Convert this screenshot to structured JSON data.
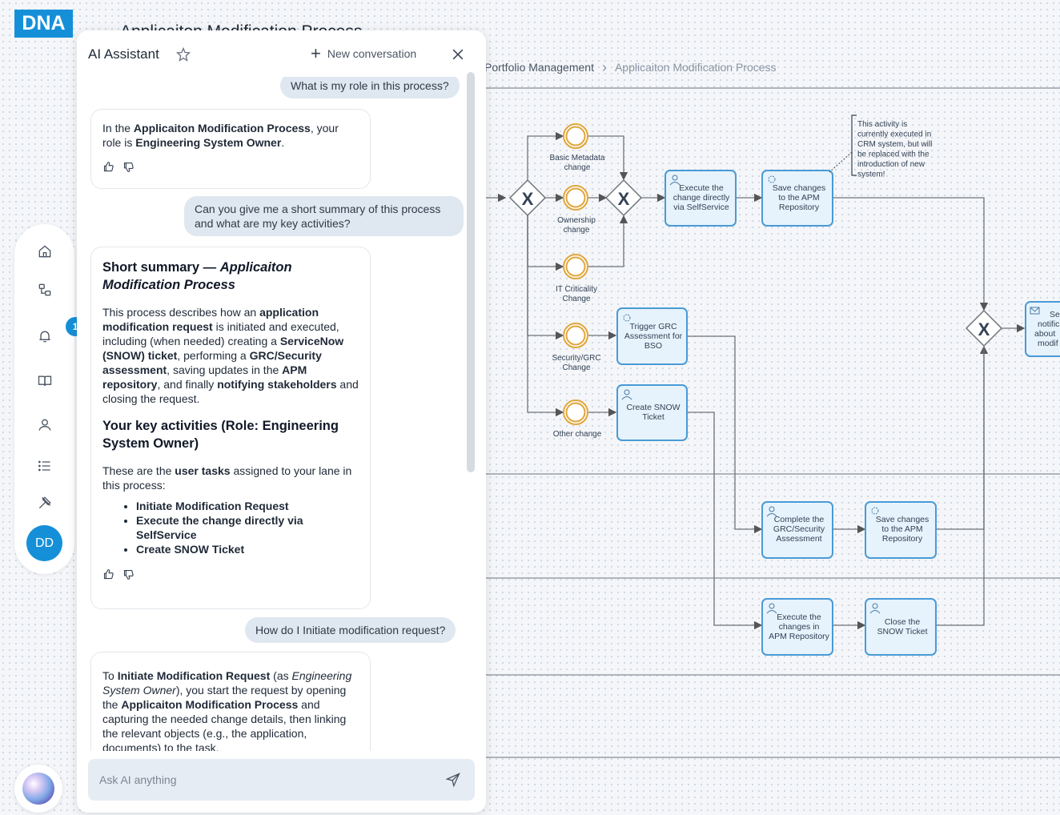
{
  "app": {
    "logo": "DNA",
    "page_title": "Applicaiton Modification Process"
  },
  "breadcrumb": {
    "parent": "Portfolio Management",
    "separator": ">",
    "current": "Applicaiton Modification Process"
  },
  "leftnav": {
    "items": [
      {
        "name": "home-icon"
      },
      {
        "name": "process-icon"
      },
      {
        "name": "bell-icon"
      },
      {
        "name": "book-icon"
      },
      {
        "name": "user-icon"
      },
      {
        "name": "list-icon"
      },
      {
        "name": "tools-icon"
      }
    ],
    "notification_count": "1",
    "avatar_initials": "DD"
  },
  "ai_panel": {
    "title": "AI Assistant",
    "new_conversation_label": "New conversation",
    "input_placeholder": "Ask AI anything",
    "messages": {
      "q1": "What is my role in this process?",
      "a1_pre": "In the ",
      "a1_process": "Applicaiton Modification Process",
      "a1_mid": ", your role is ",
      "a1_role": "Engineering System Owner",
      "a1_end": ".",
      "q2": "Can you give me a short summary of this process and what are my key activities?",
      "a2_h1": "Short summary — ",
      "a2_h1_italic": "Applicaiton Modification Process",
      "a2_p1_1": "This process describes how an ",
      "a2_p1_b1": "application modification request",
      "a2_p1_2": " is initiated and executed, including (when needed) creating a ",
      "a2_p1_b2": "ServiceNow (SNOW) ticket",
      "a2_p1_3": ", performing a ",
      "a2_p1_b3": "GRC/Security assessment",
      "a2_p1_4": ", saving updates in the ",
      "a2_p1_b4": "APM repository",
      "a2_p1_5": ", and finally ",
      "a2_p1_b5": "notifying stakeholders",
      "a2_p1_6": " and closing the request.",
      "a2_h2": "Your key activities (Role: ",
      "a2_h2_bold": "Engineering System Owner",
      "a2_h2_end": ")",
      "a2_p2_1": "These are the ",
      "a2_p2_b": "user tasks",
      "a2_p2_2": " assigned to your lane in this process:",
      "a2_list": [
        "Initiate Modification Request",
        "Execute the change directly via SelfService",
        "Create SNOW Ticket"
      ],
      "q3": "How do I Initiate modification request?",
      "a3_1": "To ",
      "a3_b1": "Initiate Modification Request",
      "a3_2": " (as ",
      "a3_i": "Engineering System Owner",
      "a3_3": "), you start the request by opening the ",
      "a3_b2": "Applicaiton Modification Process",
      "a3_4": " and capturing the needed change details, then linking the relevant objects (e.g., the application, documents) to the task."
    }
  },
  "diagram": {
    "events": [
      "Basic Metadata change",
      "Ownership change",
      "IT Criticality Change",
      "Security/GRC Change",
      "Other change"
    ],
    "tasks": {
      "execute_selfservice": "Execute the change directly via SelfService",
      "save_changes_1": "Save changes to the APM Repository",
      "trigger_grc": "Trigger GRC Assessment for BSO",
      "create_snow": "Create SNOW Ticket",
      "complete_grc": "Complete the GRC/Security Assessment",
      "save_changes_2": "Save changes to the APM Repository",
      "execute_apm": "Execute the changes in APM Repository",
      "close_snow": "Close the SNOW Ticket",
      "send_notification": "Send notification about modification"
    },
    "annotation": "This activity is currently executed in CRM system, but will be replaced with the introduction of new system!",
    "gateway_symbol": "X",
    "colors": {
      "task_fill": "#e6f3fc",
      "task_stroke": "#4a9ad6",
      "event_stroke": "#e0a63a",
      "accent": "#1590d8"
    }
  }
}
